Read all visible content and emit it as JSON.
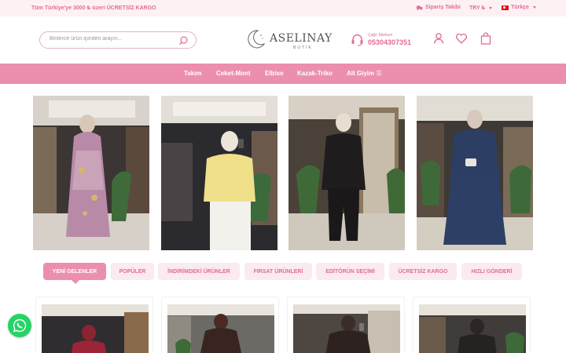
{
  "topbar": {
    "promo": "Tüm Türkiye'ye 3000 ₺ üzeri ÜCRETSİZ KARGO",
    "order_tracking": "Sipariş Takibi",
    "currency": "TRY ₺",
    "language": "Türkçe"
  },
  "header": {
    "search_placeholder": "Binlerce ürün içinden arayın...",
    "logo_name": "ASELINAY",
    "logo_sub": "BUTİK",
    "phone_label": "Çağrı Merkezi",
    "phone_number": "05304307351"
  },
  "nav": {
    "items": [
      "Takım",
      "Ceket-Mont",
      "Elbise",
      "Kazak-Triko",
      "Alt Giyim ☰"
    ]
  },
  "tabs": [
    "YENİ GELENLER",
    "POPÜLER",
    "İNDİRİMDEKİ ÜRÜNLER",
    "FIRSAT ÜRÜNLERİ",
    "EDİTÖRÜN SEÇİMİ",
    "ÜCRETSİZ KARGO",
    "HIZLI GÖNDERİ"
  ],
  "active_tab": "YENİ GELENLER",
  "colors": {
    "accent": "#ec8fae",
    "accent_text": "#e46b95",
    "whatsapp": "#25d366"
  },
  "icons": [
    "truck-icon",
    "search-icon",
    "moon-logo-icon",
    "headset-icon",
    "user-icon",
    "heart-icon",
    "bag-icon",
    "whatsapp-icon"
  ]
}
